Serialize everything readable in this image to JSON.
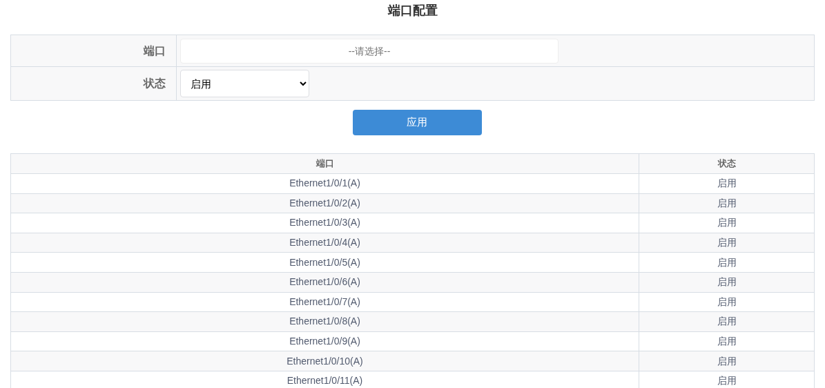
{
  "title": "端口配置",
  "form": {
    "port": {
      "label": "端口",
      "placeholder": "--请选择--"
    },
    "status": {
      "label": "状态",
      "value": "启用"
    },
    "apply_button": "应用"
  },
  "table": {
    "columns": [
      "端口",
      "状态"
    ],
    "rows": [
      {
        "port": "Ethernet1/0/1(A)",
        "status": "启用"
      },
      {
        "port": "Ethernet1/0/2(A)",
        "status": "启用"
      },
      {
        "port": "Ethernet1/0/3(A)",
        "status": "启用"
      },
      {
        "port": "Ethernet1/0/4(A)",
        "status": "启用"
      },
      {
        "port": "Ethernet1/0/5(A)",
        "status": "启用"
      },
      {
        "port": "Ethernet1/0/6(A)",
        "status": "启用"
      },
      {
        "port": "Ethernet1/0/7(A)",
        "status": "启用"
      },
      {
        "port": "Ethernet1/0/8(A)",
        "status": "启用"
      },
      {
        "port": "Ethernet1/0/9(A)",
        "status": "启用"
      },
      {
        "port": "Ethernet1/0/10(A)",
        "status": "启用"
      },
      {
        "port": "Ethernet1/0/11(A)",
        "status": "启用"
      }
    ]
  }
}
